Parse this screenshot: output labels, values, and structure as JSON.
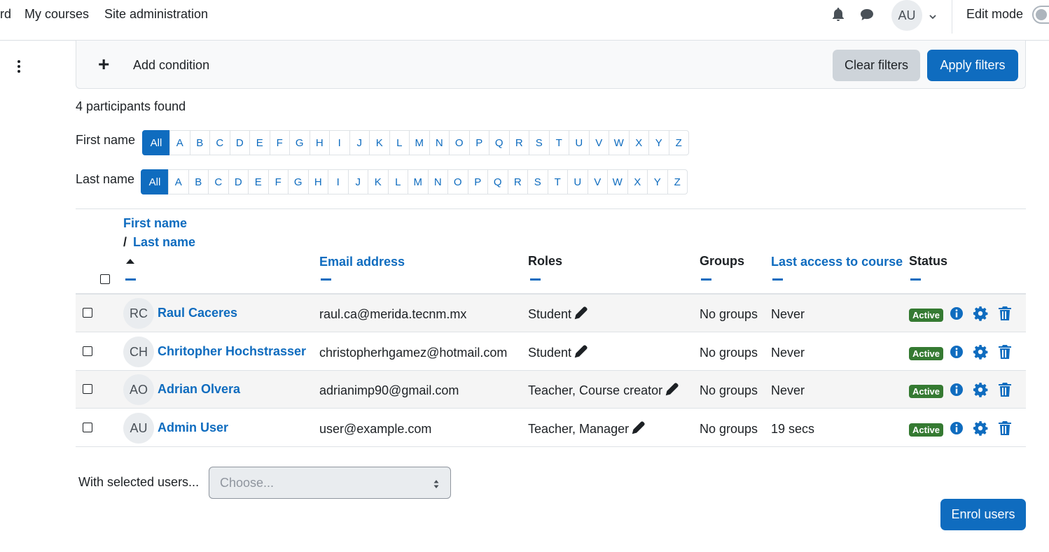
{
  "navbar": {
    "partial_link": "rd",
    "my_courses": "My courses",
    "site_admin": "Site administration",
    "avatar_initials": "AU",
    "edit_mode": "Edit mode"
  },
  "filters": {
    "add_condition": "Add condition",
    "clear": "Clear filters",
    "apply": "Apply filters"
  },
  "participants_found": "4 participants found",
  "initials": {
    "first_label": "First name",
    "last_label": "Last name",
    "all": "All",
    "letters": [
      "A",
      "B",
      "C",
      "D",
      "E",
      "F",
      "G",
      "H",
      "I",
      "J",
      "K",
      "L",
      "M",
      "N",
      "O",
      "P",
      "Q",
      "R",
      "S",
      "T",
      "U",
      "V",
      "W",
      "X",
      "Y",
      "Z"
    ]
  },
  "table": {
    "headers": {
      "first_name": "First name",
      "slash": "/",
      "last_name": "Last name",
      "email": "Email address",
      "roles": "Roles",
      "groups": "Groups",
      "last_access": "Last access to course",
      "status": "Status"
    },
    "rows": [
      {
        "initials": "RC",
        "name": "Raul Caceres",
        "email": "raul.ca@merida.tecnm.mx",
        "roles": "Student",
        "groups": "No groups",
        "last_access": "Never",
        "status": "Active"
      },
      {
        "initials": "CH",
        "name": "Chritopher Hochstrasser",
        "email": "christopherhgamez@hotmail.com",
        "roles": "Student",
        "groups": "No groups",
        "last_access": "Never",
        "status": "Active"
      },
      {
        "initials": "AO",
        "name": "Adrian Olvera",
        "email": "adrianimp90@gmail.com",
        "roles": "Teacher, Course creator",
        "groups": "No groups",
        "last_access": "Never",
        "status": "Active"
      },
      {
        "initials": "AU",
        "name": "Admin User",
        "email": "user@example.com",
        "roles": "Teacher, Manager",
        "groups": "No groups",
        "last_access": "19 secs",
        "status": "Active"
      }
    ]
  },
  "bulk": {
    "label": "With selected users...",
    "placeholder": "Choose..."
  },
  "enrol_button": "Enrol users",
  "colors": {
    "primary": "#0f6cbf",
    "active_badge": "#357a32"
  }
}
